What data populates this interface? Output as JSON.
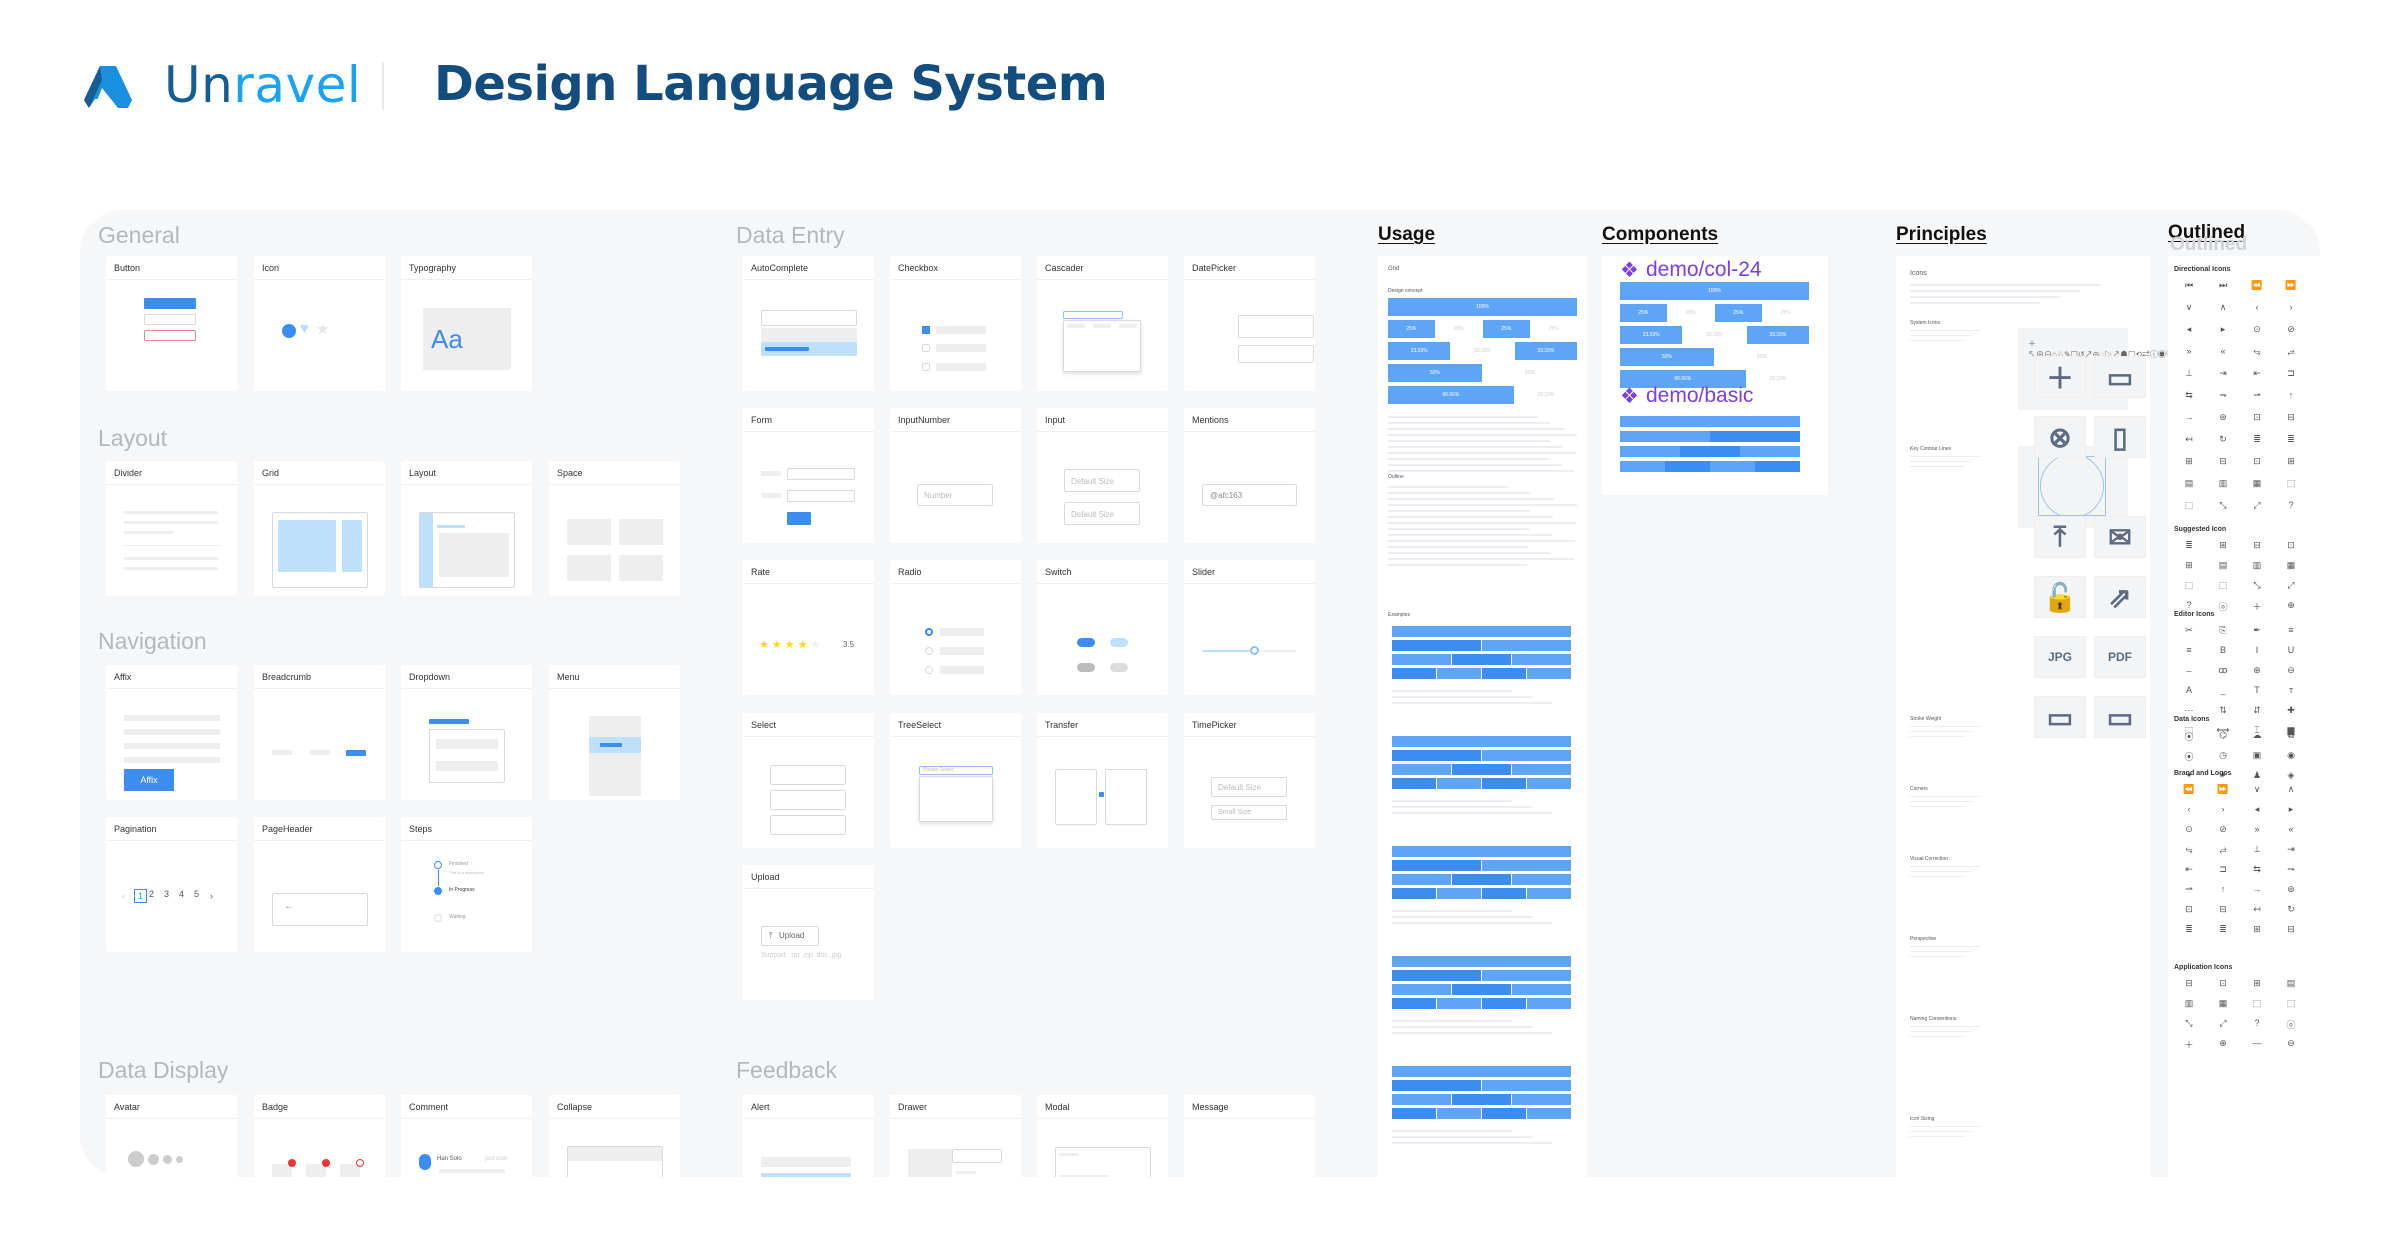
{
  "header": {
    "brand_part1": "Un",
    "brand_part2": "ravel",
    "title": "Design Language System",
    "brand_colors": {
      "dark": "#165d93",
      "light": "#1aa3f2"
    }
  },
  "sections": [
    {
      "title": "General",
      "cards": [
        {
          "title": "Button"
        },
        {
          "title": "Icon"
        },
        {
          "title": "Typography",
          "texts": [
            "Aa"
          ]
        }
      ]
    },
    {
      "title": "Layout",
      "cards": [
        {
          "title": "Divider"
        },
        {
          "title": "Grid"
        },
        {
          "title": "Layout"
        },
        {
          "title": "Space"
        }
      ]
    },
    {
      "title": "Navigation",
      "cards": [
        {
          "title": "Affix",
          "texts": [
            "Affix"
          ]
        },
        {
          "title": "Breadcrumb"
        },
        {
          "title": "Dropdown"
        },
        {
          "title": "Menu"
        },
        {
          "title": "Pagination",
          "texts": [
            "1",
            "2",
            "3",
            "4",
            "5"
          ]
        },
        {
          "title": "PageHeader"
        },
        {
          "title": "Steps",
          "texts": [
            "Finished",
            "In Progress",
            "Waiting",
            "This is a description"
          ]
        }
      ]
    },
    {
      "title": "Data Display",
      "cards": [
        {
          "title": "Avatar"
        },
        {
          "title": "Badge"
        },
        {
          "title": "Comment",
          "texts": [
            "Han Solo",
            "just now"
          ]
        },
        {
          "title": "Collapse"
        }
      ]
    },
    {
      "title": "Data Entry",
      "cards": [
        {
          "title": "AutoComplete"
        },
        {
          "title": "Checkbox"
        },
        {
          "title": "Cascader"
        },
        {
          "title": "DatePicker"
        },
        {
          "title": "Form"
        },
        {
          "title": "InputNumber",
          "texts": [
            "Number"
          ]
        },
        {
          "title": "Input",
          "texts": [
            "Default Size",
            "Default Size"
          ]
        },
        {
          "title": "Mentions",
          "texts": [
            "@afc163"
          ]
        },
        {
          "title": "Rate",
          "texts": [
            "3.5"
          ]
        },
        {
          "title": "Radio"
        },
        {
          "title": "Switch"
        },
        {
          "title": "Slider"
        },
        {
          "title": "Select"
        },
        {
          "title": "TreeSelect",
          "texts": [
            "Please Select"
          ]
        },
        {
          "title": "Transfer"
        },
        {
          "title": "TimePicker",
          "texts": [
            "Default Size",
            "Small Size"
          ]
        },
        {
          "title": "Upload",
          "texts": [
            "Upload",
            "Support: .rar .zip .doc .jpg"
          ]
        }
      ]
    },
    {
      "title": "Feedback",
      "cards": [
        {
          "title": "Alert"
        },
        {
          "title": "Drawer"
        },
        {
          "title": "Modal"
        },
        {
          "title": "Message"
        }
      ]
    }
  ],
  "rate_value": 3.5,
  "slider_value": 0.55,
  "usage": {
    "title": "Usage",
    "heading": "Grid",
    "design_concept": "Design concept",
    "outline": "Outline",
    "examples": "Examples",
    "rows": [
      [
        "100%"
      ],
      [
        "25%",
        "25%",
        "25%",
        "25%"
      ],
      [
        "33.33%",
        "33.33%",
        "33.33%"
      ],
      [
        "50%",
        "50%"
      ],
      [
        "66.66%",
        "33.33%"
      ]
    ]
  },
  "components": {
    "title": "Components",
    "demo1": "demo/col-24",
    "demo2": "demo/basic",
    "accent": "#7b3fe4"
  },
  "principles": {
    "title": "Principles",
    "heading": "Icons",
    "items": [
      "System Icons",
      "Key Contour Lines",
      "Stroke Weight",
      "Corners",
      "Visual Correction",
      "Perspective",
      "Naming Conventions",
      "Icon Sizing"
    ],
    "jpg": "JPG",
    "pdf": "PDF"
  },
  "outlined": {
    "title": "Outlined",
    "ghost": "Outlined",
    "groups": [
      "Directional Icons",
      "Suggested Icon",
      "Editor Icons",
      "Data Icons",
      "Brand and Logos",
      "Application Icons"
    ]
  }
}
